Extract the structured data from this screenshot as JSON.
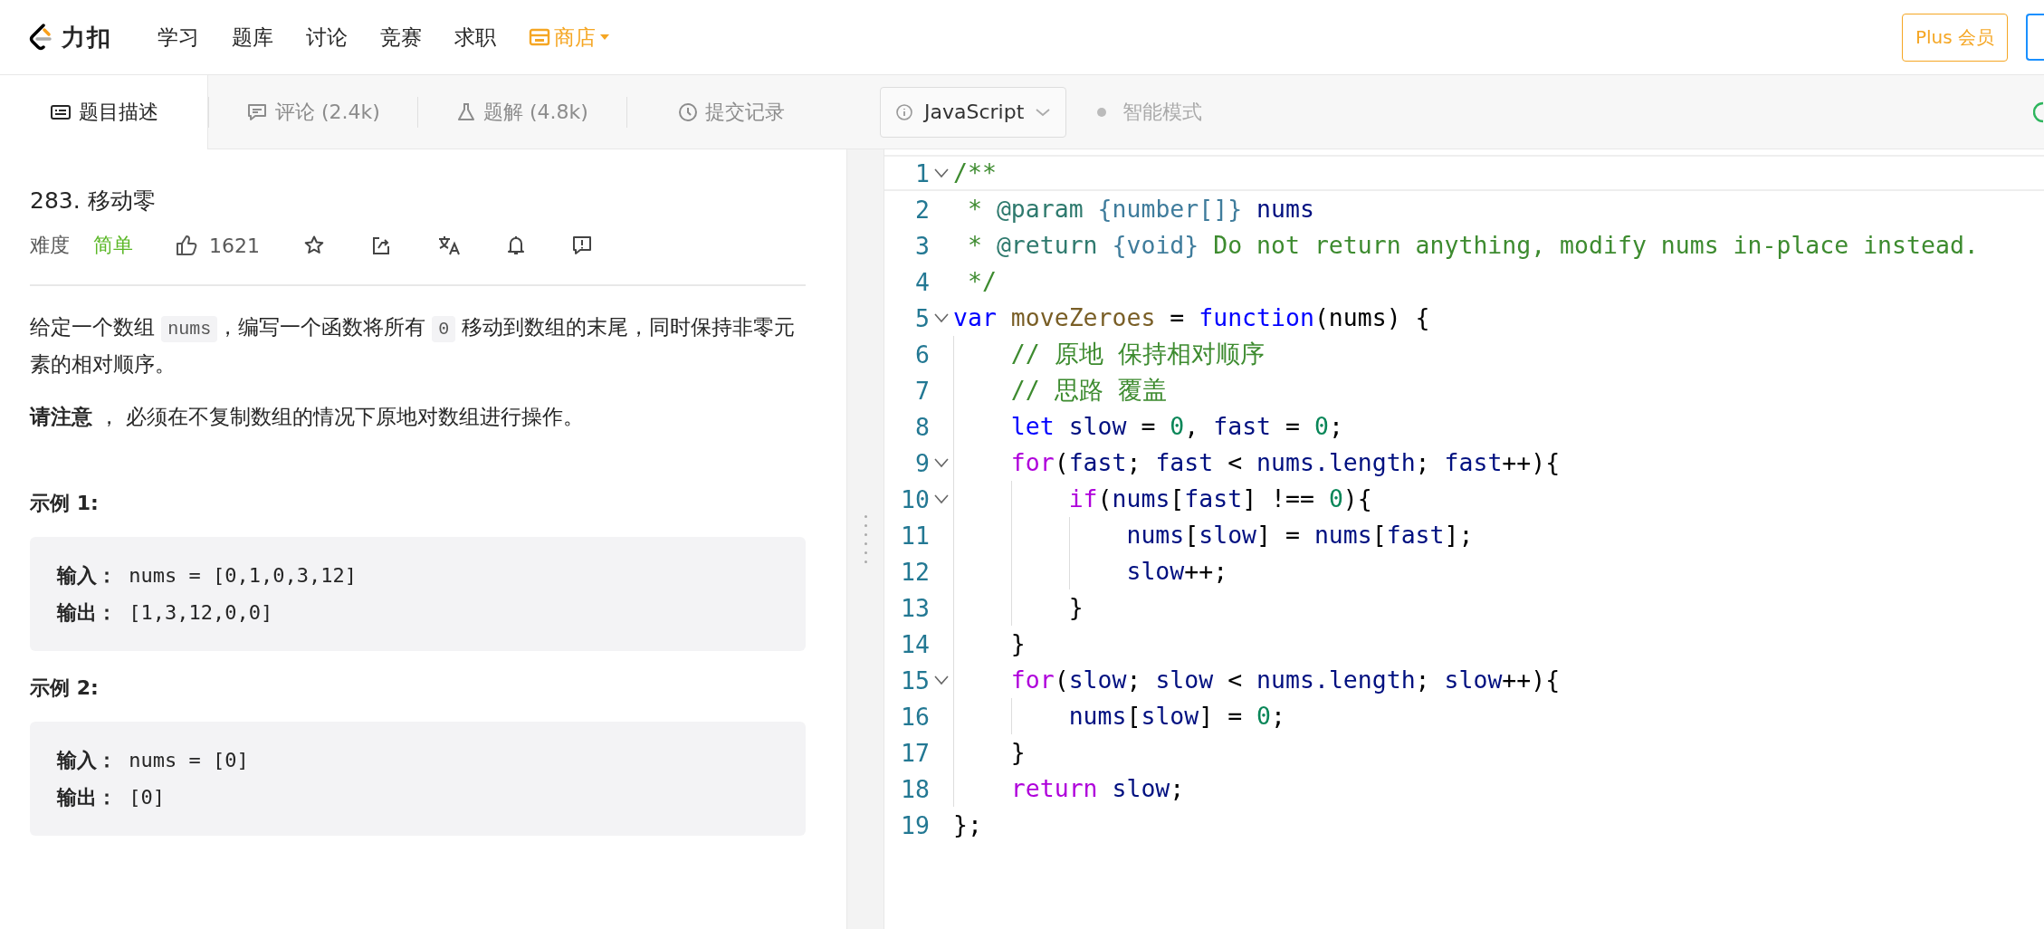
{
  "nav": {
    "brand": "力扣",
    "items": [
      {
        "label": "学习",
        "kind": "plain"
      },
      {
        "label": "题库",
        "kind": "plain"
      },
      {
        "label": "讨论",
        "kind": "plain"
      },
      {
        "label": "竞赛",
        "kind": "plain"
      },
      {
        "label": "求职",
        "kind": "plain"
      },
      {
        "label": "商店",
        "kind": "store"
      }
    ],
    "plus_button": "Plus 会员"
  },
  "tabs": [
    {
      "label": "题目描述",
      "selected": true
    },
    {
      "label": "评论 (2.4k)",
      "selected": false
    },
    {
      "label": "题解 (4.8k)",
      "selected": false
    },
    {
      "label": "提交记录",
      "selected": false
    }
  ],
  "language": "JavaScript",
  "smart_mode": {
    "label": "智能模式",
    "on": false
  },
  "problem": {
    "title": "283. 移动零",
    "difficulty_label": "难度",
    "difficulty": "简单",
    "likes": "1621",
    "description": [
      {
        "kind": "text",
        "text": "给定一个数组 "
      },
      {
        "kind": "code",
        "text": "nums"
      },
      {
        "kind": "text",
        "text": "，编写一个函数将所有 "
      },
      {
        "kind": "code",
        "text": "0"
      },
      {
        "kind": "text",
        "text": " 移动到数组的末尾，同时保持非零元素的相对顺序。"
      }
    ],
    "note": "**请注意** ， 必须在不复制数组的情况下原地对数组进行操作。",
    "examples": [
      {
        "title": "示例 1:",
        "lines": [
          "**输入：** nums = [0,1,0,3,12]",
          "**输出：** [1,3,12,0,0]"
        ]
      },
      {
        "title": "示例 2:",
        "lines": [
          "**输入：** nums = [0]",
          "**输出：** [0]"
        ]
      }
    ]
  },
  "code": [
    {
      "number": "1",
      "foldable": true,
      "current": true,
      "tokens": [
        {
          "kind": "comment",
          "text": "/**"
        }
      ]
    },
    {
      "number": "2",
      "foldable": false,
      "current": false,
      "tokens": [
        {
          "kind": "comment",
          "text": " * "
        },
        {
          "kind": "doctag",
          "text": "@param"
        },
        {
          "kind": "doctype",
          "text": " {number[]}"
        },
        {
          "kind": "ident",
          "text": " nums"
        }
      ]
    },
    {
      "number": "3",
      "foldable": false,
      "current": false,
      "tokens": [
        {
          "kind": "comment",
          "text": " * "
        },
        {
          "kind": "doctag",
          "text": "@return"
        },
        {
          "kind": "doctype",
          "text": " {void}"
        },
        {
          "kind": "comment",
          "text": " Do not return anything, modify nums in-place instead."
        }
      ]
    },
    {
      "number": "4",
      "foldable": false,
      "current": false,
      "tokens": [
        {
          "kind": "comment",
          "text": " */"
        }
      ]
    },
    {
      "number": "5",
      "foldable": true,
      "current": false,
      "tokens": [
        {
          "kind": "keyword",
          "text": "var"
        },
        {
          "kind": "fn",
          "text": " moveZeroes"
        },
        {
          "kind": "punct",
          "text": " = "
        },
        {
          "kind": "keyword",
          "text": "function"
        },
        {
          "kind": "punct",
          "text": "(nums) {"
        }
      ]
    },
    {
      "number": "6",
      "foldable": false,
      "current": false,
      "tokens": [
        {
          "kind": "comment",
          "text": "    // 原地 保持相对顺序"
        }
      ]
    },
    {
      "number": "7",
      "foldable": false,
      "current": false,
      "tokens": [
        {
          "kind": "comment",
          "text": "    // 思路 覆盖"
        }
      ]
    },
    {
      "number": "8",
      "foldable": false,
      "current": false,
      "tokens": [
        {
          "kind": "keyword",
          "text": "    let"
        },
        {
          "kind": "ident",
          "text": " slow"
        },
        {
          "kind": "punct",
          "text": " = "
        },
        {
          "kind": "number",
          "text": "0"
        },
        {
          "kind": "punct",
          "text": ", "
        },
        {
          "kind": "ident",
          "text": "fast"
        },
        {
          "kind": "punct",
          "text": " = "
        },
        {
          "kind": "number",
          "text": "0"
        },
        {
          "kind": "punct",
          "text": ";"
        }
      ]
    },
    {
      "number": "9",
      "foldable": true,
      "current": false,
      "tokens": [
        {
          "kind": "control",
          "text": "    for"
        },
        {
          "kind": "punct",
          "text": "("
        },
        {
          "kind": "ident",
          "text": "fast"
        },
        {
          "kind": "punct",
          "text": "; "
        },
        {
          "kind": "ident",
          "text": "fast"
        },
        {
          "kind": "punct",
          "text": " < "
        },
        {
          "kind": "ident",
          "text": "nums.length"
        },
        {
          "kind": "punct",
          "text": "; "
        },
        {
          "kind": "ident",
          "text": "fast"
        },
        {
          "kind": "punct",
          "text": "++){"
        }
      ]
    },
    {
      "number": "10",
      "foldable": true,
      "current": false,
      "tokens": [
        {
          "kind": "control",
          "text": "        if"
        },
        {
          "kind": "punct",
          "text": "("
        },
        {
          "kind": "ident",
          "text": "nums"
        },
        {
          "kind": "punct",
          "text": "["
        },
        {
          "kind": "ident",
          "text": "fast"
        },
        {
          "kind": "punct",
          "text": "] !== "
        },
        {
          "kind": "number",
          "text": "0"
        },
        {
          "kind": "punct",
          "text": "){"
        }
      ]
    },
    {
      "number": "11",
      "foldable": false,
      "current": false,
      "tokens": [
        {
          "kind": "ident",
          "text": "            nums"
        },
        {
          "kind": "punct",
          "text": "["
        },
        {
          "kind": "ident",
          "text": "slow"
        },
        {
          "kind": "punct",
          "text": "] = "
        },
        {
          "kind": "ident",
          "text": "nums"
        },
        {
          "kind": "punct",
          "text": "["
        },
        {
          "kind": "ident",
          "text": "fast"
        },
        {
          "kind": "punct",
          "text": "];"
        }
      ]
    },
    {
      "number": "12",
      "foldable": false,
      "current": false,
      "tokens": [
        {
          "kind": "ident",
          "text": "            slow"
        },
        {
          "kind": "punct",
          "text": "++;"
        }
      ]
    },
    {
      "number": "13",
      "foldable": false,
      "current": false,
      "tokens": [
        {
          "kind": "punct",
          "text": "        }"
        }
      ]
    },
    {
      "number": "14",
      "foldable": false,
      "current": false,
      "tokens": [
        {
          "kind": "punct",
          "text": "    }"
        }
      ]
    },
    {
      "number": "15",
      "foldable": true,
      "current": false,
      "tokens": [
        {
          "kind": "control",
          "text": "    for"
        },
        {
          "kind": "punct",
          "text": "("
        },
        {
          "kind": "ident",
          "text": "slow"
        },
        {
          "kind": "punct",
          "text": "; "
        },
        {
          "kind": "ident",
          "text": "slow"
        },
        {
          "kind": "punct",
          "text": " < "
        },
        {
          "kind": "ident",
          "text": "nums.length"
        },
        {
          "kind": "punct",
          "text": "; "
        },
        {
          "kind": "ident",
          "text": "slow"
        },
        {
          "kind": "punct",
          "text": "++){"
        }
      ]
    },
    {
      "number": "16",
      "foldable": false,
      "current": false,
      "tokens": [
        {
          "kind": "ident",
          "text": "        nums"
        },
        {
          "kind": "punct",
          "text": "["
        },
        {
          "kind": "ident",
          "text": "slow"
        },
        {
          "kind": "punct",
          "text": "] = "
        },
        {
          "kind": "number",
          "text": "0"
        },
        {
          "kind": "punct",
          "text": ";"
        }
      ]
    },
    {
      "number": "17",
      "foldable": false,
      "current": false,
      "tokens": [
        {
          "kind": "punct",
          "text": "    }"
        }
      ]
    },
    {
      "number": "18",
      "foldable": false,
      "current": false,
      "tokens": [
        {
          "kind": "control",
          "text": "    return"
        },
        {
          "kind": "ident",
          "text": " slow"
        },
        {
          "kind": "punct",
          "text": ";"
        }
      ]
    },
    {
      "number": "19",
      "foldable": false,
      "current": false,
      "tokens": [
        {
          "kind": "punct",
          "text": "};"
        }
      ]
    }
  ]
}
